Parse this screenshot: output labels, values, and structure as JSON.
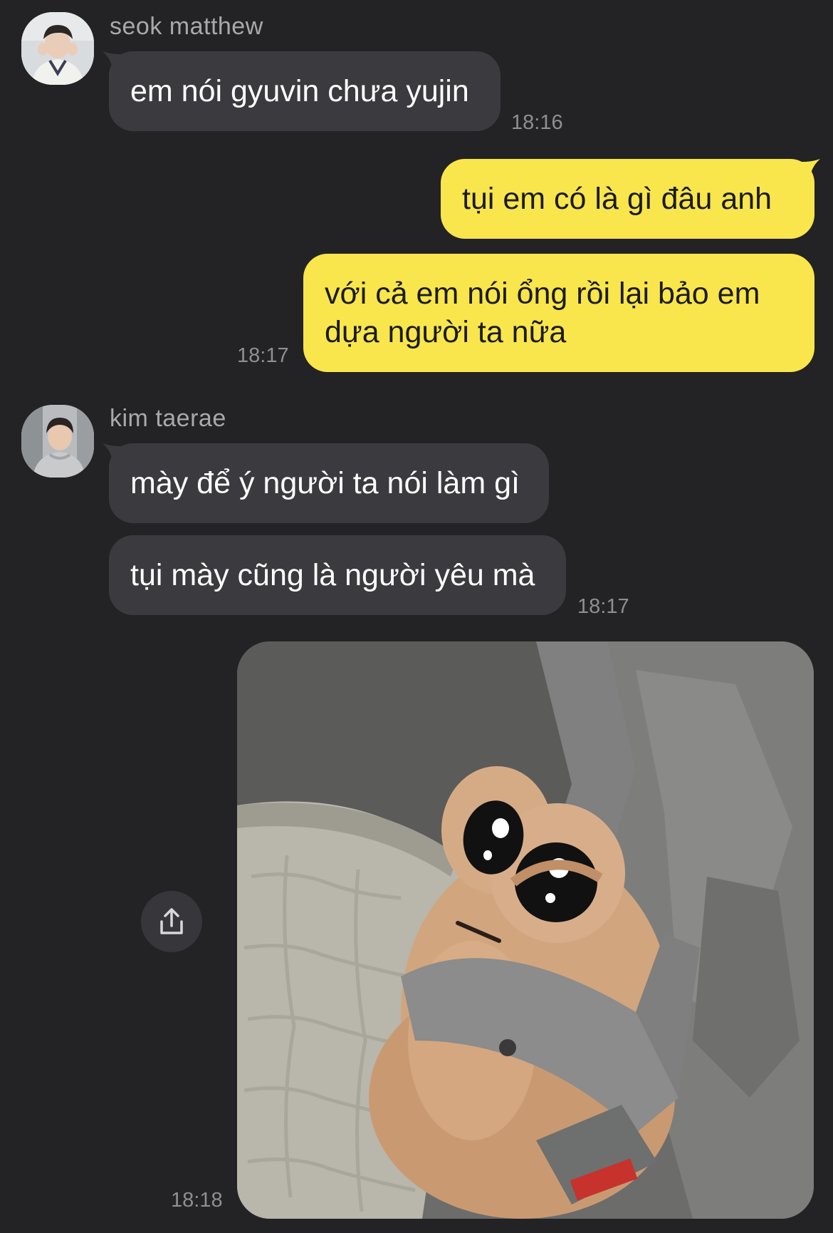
{
  "conversation": {
    "messages": [
      {
        "sender": "seok matthew",
        "text": "em nói gyuvin chưa yujin",
        "time": "18:16"
      },
      {
        "sender": "me",
        "text": "tụi em có là gì đâu anh"
      },
      {
        "sender": "me",
        "text": "với cả em nói ổng rồi lại bảo em dựa người ta nữa",
        "time": "18:17"
      },
      {
        "sender": "kim taerae",
        "text": "mày để ý người ta nói làm gì"
      },
      {
        "sender": "kim taerae",
        "text": "tụi mày cũng là người yêu mà",
        "time": "18:17"
      },
      {
        "sender": "me",
        "attachment": "photo",
        "time": "18:18"
      }
    ]
  },
  "icons": {
    "share": "share-icon"
  },
  "colors": {
    "background": "#232225",
    "incoming_bubble": "#3b3a3e",
    "outgoing_bubble": "#f9e64c",
    "sender_name": "#a9a9ad",
    "timestamp": "#8f8f93"
  }
}
